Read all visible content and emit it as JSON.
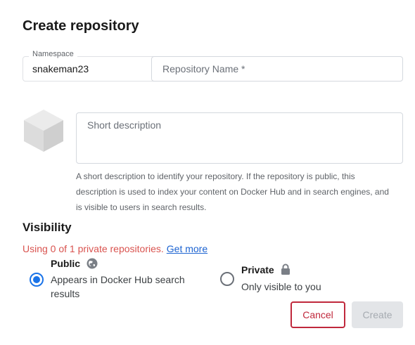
{
  "page": {
    "title": "Create repository"
  },
  "namespace": {
    "label": "Namespace",
    "value": "snakeman23"
  },
  "repository_name": {
    "placeholder": "Repository Name *",
    "value": ""
  },
  "description": {
    "placeholder": "Short description",
    "helper_text": "A short description to identify your repository. If the repository is public, this description is used to index your content on Docker Hub and in search engines, and is visible to users in search results."
  },
  "visibility": {
    "title": "Visibility",
    "private_usage": "Using 0 of 1 private repositories.",
    "get_more_link": "Get more",
    "options": [
      {
        "label": "Public",
        "description": "Appears in Docker Hub search results",
        "selected": true,
        "icon": "globe-icon"
      },
      {
        "label": "Private",
        "description": "Only visible to you",
        "selected": false,
        "icon": "lock-icon"
      }
    ]
  },
  "actions": {
    "cancel_label": "Cancel",
    "create_label": "Create",
    "create_disabled": true
  },
  "colors": {
    "accent": "#1a73e8",
    "danger": "#c0283c",
    "warning_text": "#d9534f",
    "link": "#1c63d1"
  }
}
